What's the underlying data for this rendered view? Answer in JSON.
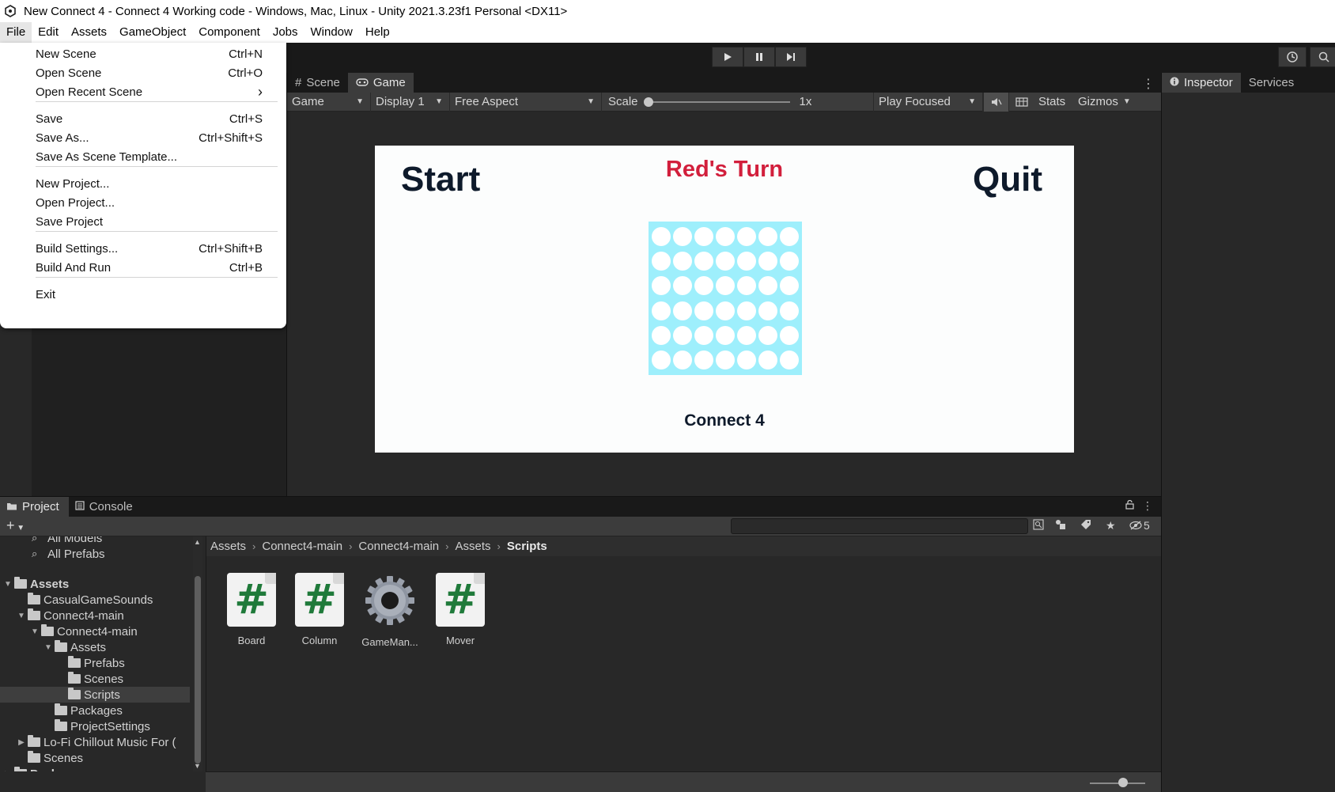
{
  "window": {
    "title": "New Connect 4 - Connect 4 Working code - Windows, Mac, Linux - Unity 2021.3.23f1 Personal <DX11>"
  },
  "menubar": [
    "File",
    "Edit",
    "Assets",
    "GameObject",
    "Component",
    "Jobs",
    "Window",
    "Help"
  ],
  "file_menu": {
    "items": [
      {
        "label": "New Scene",
        "shortcut": "Ctrl+N"
      },
      {
        "label": "Open Scene",
        "shortcut": "Ctrl+O"
      },
      {
        "label": "Open Recent Scene",
        "shortcut": "›"
      },
      {
        "label": "Save",
        "shortcut": "Ctrl+S"
      },
      {
        "label": "Save As...",
        "shortcut": "Ctrl+Shift+S"
      },
      {
        "label": "Save As Scene Template...",
        "shortcut": ""
      },
      {
        "label": "New Project...",
        "shortcut": ""
      },
      {
        "label": "Open Project...",
        "shortcut": ""
      },
      {
        "label": "Save Project",
        "shortcut": ""
      },
      {
        "label": "Build Settings...",
        "shortcut": "Ctrl+Shift+B"
      },
      {
        "label": "Build And Run",
        "shortcut": "Ctrl+B"
      },
      {
        "label": "Exit",
        "shortcut": ""
      }
    ]
  },
  "game_view": {
    "tabs": [
      "Scene",
      "Game"
    ],
    "game_dropdown": "Game",
    "display": "Display 1",
    "aspect": "Free Aspect",
    "scale_label": "Scale",
    "scale_value": "1x",
    "play_mode": "Play Focused",
    "stats": "Stats",
    "gizmos": "Gizmos"
  },
  "game_screen": {
    "start": "Start",
    "quit": "Quit",
    "turn": "Red's Turn",
    "subtitle": "Connect 4",
    "board_color": "#9eeffc",
    "turn_color": "#d21f3c"
  },
  "inspector": {
    "tabs": [
      "Inspector",
      "Services"
    ]
  },
  "bottom": {
    "tabs": [
      "Project",
      "Console"
    ],
    "hidden_count": "5",
    "tree": [
      {
        "label": "All Models",
        "type": "search",
        "indent": 0
      },
      {
        "label": "All Prefabs",
        "type": "search",
        "indent": 0
      },
      {
        "label": "Assets",
        "type": "folder",
        "indent": 0,
        "bold": true
      },
      {
        "label": "CasualGameSounds",
        "type": "folder",
        "indent": 1
      },
      {
        "label": "Connect4-main",
        "type": "folder",
        "indent": 1
      },
      {
        "label": "Connect4-main",
        "type": "folder",
        "indent": 2
      },
      {
        "label": "Assets",
        "type": "folder",
        "indent": 3
      },
      {
        "label": "Prefabs",
        "type": "folder",
        "indent": 4
      },
      {
        "label": "Scenes",
        "type": "folder",
        "indent": 4
      },
      {
        "label": "Scripts",
        "type": "folder",
        "indent": 4,
        "selected": true
      },
      {
        "label": "Packages",
        "type": "folder",
        "indent": 3
      },
      {
        "label": "ProjectSettings",
        "type": "folder",
        "indent": 3
      },
      {
        "label": "Lo-Fi Chillout Music For (",
        "type": "folder",
        "indent": 1
      },
      {
        "label": "Scenes",
        "type": "folder",
        "indent": 1
      },
      {
        "label": "Packages",
        "type": "folder",
        "indent": 0,
        "bold": true
      }
    ],
    "breadcrumbs": [
      "Assets",
      "Connect4-main",
      "Connect4-main",
      "Assets",
      "Scripts"
    ],
    "assets": [
      {
        "label": "Board",
        "kind": "script"
      },
      {
        "label": "Column",
        "kind": "script"
      },
      {
        "label": "GameMan...",
        "kind": "gear"
      },
      {
        "label": "Mover",
        "kind": "script"
      }
    ]
  }
}
